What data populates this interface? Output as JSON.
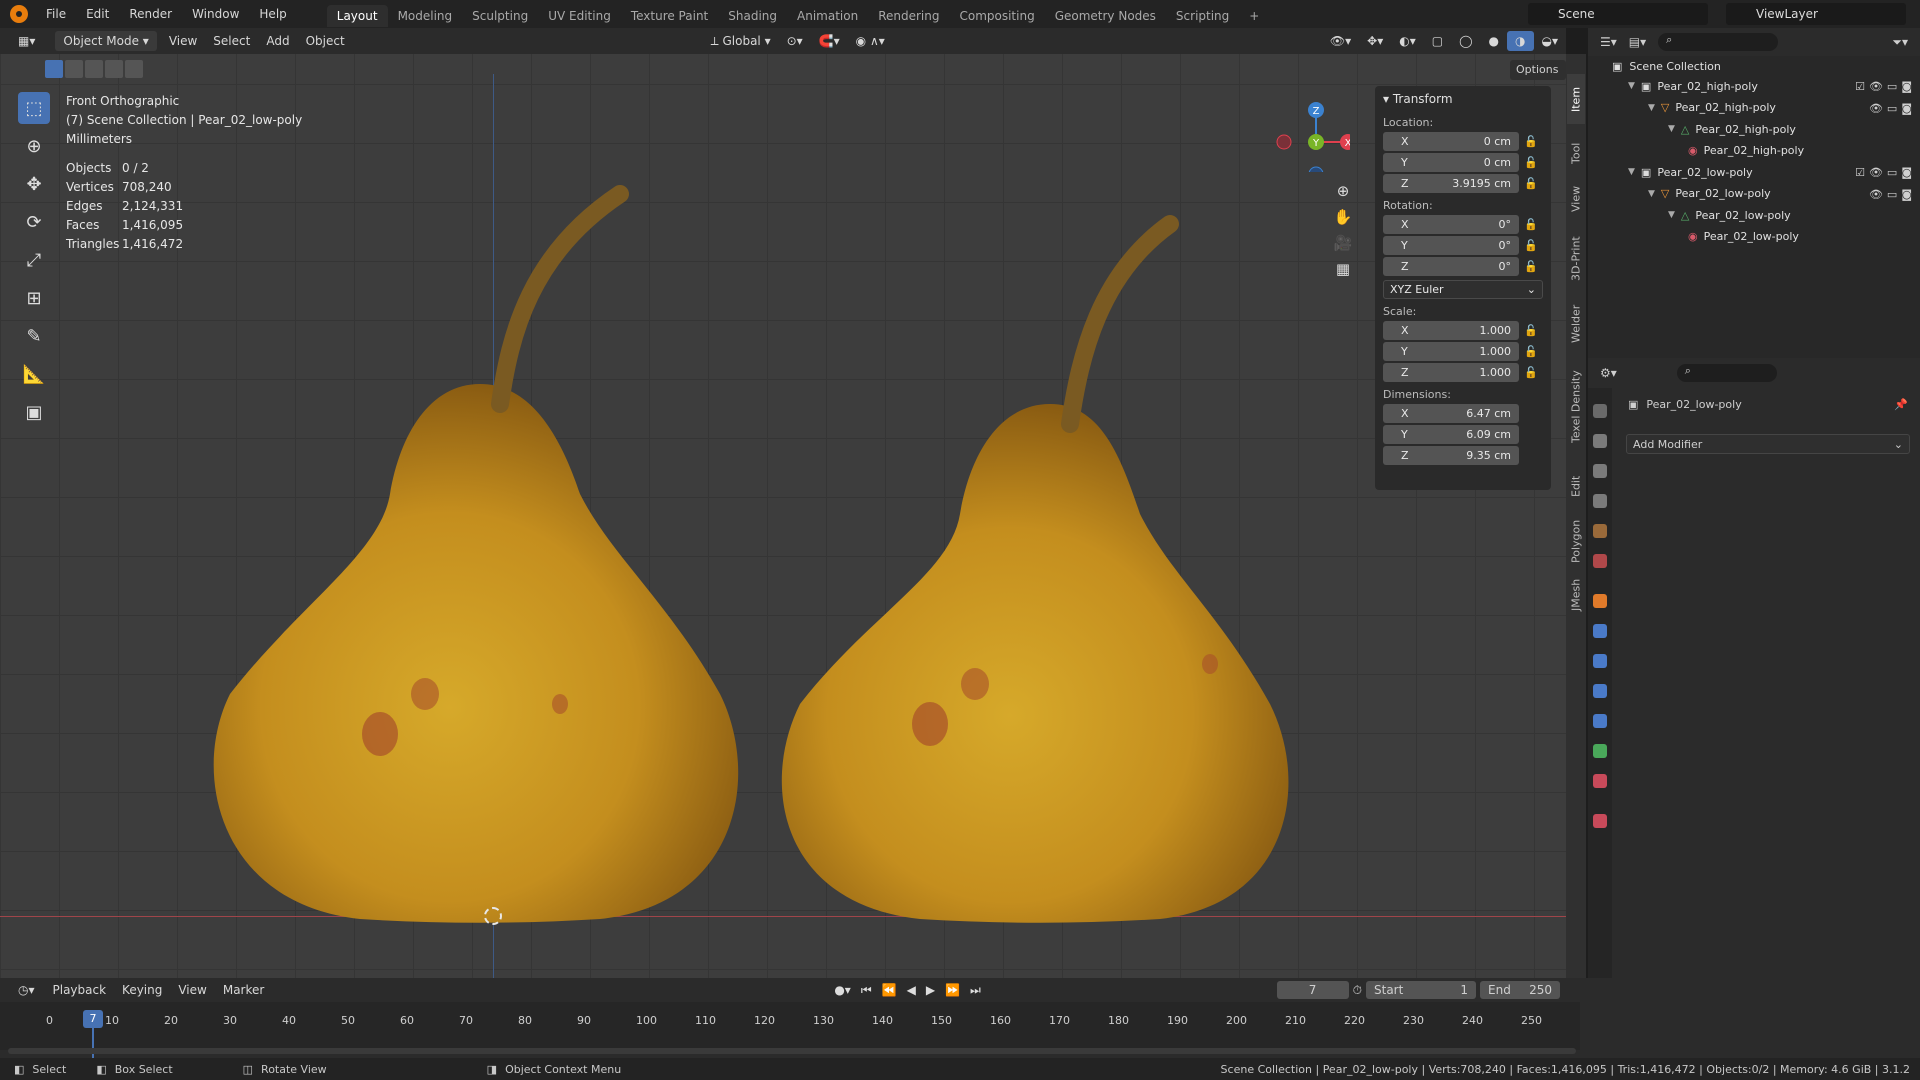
{
  "topbar": {
    "menus": [
      "File",
      "Edit",
      "Render",
      "Window",
      "Help"
    ],
    "workspaces": [
      "Layout",
      "Modeling",
      "Sculpting",
      "UV Editing",
      "Texture Paint",
      "Shading",
      "Animation",
      "Rendering",
      "Compositing",
      "Geometry Nodes",
      "Scripting"
    ],
    "active_workspace": "Layout",
    "add_tab": "+",
    "scene": "Scene",
    "view_layer": "ViewLayer"
  },
  "viewport_header": {
    "mode": "Object Mode",
    "menus": [
      "View",
      "Select",
      "Add",
      "Object"
    ],
    "orientation": "Global",
    "options": "Options"
  },
  "overlay": {
    "view_name": "Front Orthographic",
    "collection": "(7) Scene Collection | Pear_02_low-poly",
    "units": "Millimeters",
    "stats": [
      {
        "k": "Objects",
        "v": "0 / 2"
      },
      {
        "k": "Vertices",
        "v": "708,240"
      },
      {
        "k": "Edges",
        "v": "2,124,331"
      },
      {
        "k": "Faces",
        "v": "1,416,095"
      },
      {
        "k": "Triangles",
        "v": "1,416,472"
      }
    ]
  },
  "gizmo": {
    "x": "X",
    "y": "Y",
    "z": "Z",
    "colors": {
      "x": "#e0404e",
      "y": "#79b527",
      "z": "#3b82d0"
    }
  },
  "npanel": {
    "title": "Transform",
    "location_label": "Location:",
    "location": [
      {
        "axis": "X",
        "value": "0 cm"
      },
      {
        "axis": "Y",
        "value": "0 cm"
      },
      {
        "axis": "Z",
        "value": "3.9195 cm"
      }
    ],
    "rotation_label": "Rotation:",
    "rotation": [
      {
        "axis": "X",
        "value": "0°"
      },
      {
        "axis": "Y",
        "value": "0°"
      },
      {
        "axis": "Z",
        "value": "0°"
      }
    ],
    "rotation_mode": "XYZ Euler",
    "scale_label": "Scale:",
    "scale": [
      {
        "axis": "X",
        "value": "1.000"
      },
      {
        "axis": "Y",
        "value": "1.000"
      },
      {
        "axis": "Z",
        "value": "1.000"
      }
    ],
    "dimensions_label": "Dimensions:",
    "dimensions": [
      {
        "axis": "X",
        "value": "6.47 cm"
      },
      {
        "axis": "Y",
        "value": "6.09 cm"
      },
      {
        "axis": "Z",
        "value": "9.35 cm"
      }
    ]
  },
  "sidebar_tabs": [
    "Item",
    "Tool",
    "View",
    "3D-Print",
    "Welder",
    "Texel Density",
    "Edit",
    "Polygon",
    "JMesh"
  ],
  "outliner": {
    "root": "Scene Collection",
    "rows": [
      {
        "label": "Pear_02_high-poly",
        "indent": 1,
        "type": "collection"
      },
      {
        "label": "Pear_02_high-poly",
        "indent": 2,
        "type": "object"
      },
      {
        "label": "Pear_02_high-poly",
        "indent": 3,
        "type": "mesh"
      },
      {
        "label": "Pear_02_high-poly",
        "indent": 4,
        "type": "material"
      },
      {
        "label": "Pear_02_low-poly",
        "indent": 1,
        "type": "collection"
      },
      {
        "label": "Pear_02_low-poly",
        "indent": 2,
        "type": "object"
      },
      {
        "label": "Pear_02_low-poly",
        "indent": 3,
        "type": "mesh"
      },
      {
        "label": "Pear_02_low-poly",
        "indent": 4,
        "type": "material"
      }
    ]
  },
  "properties": {
    "object_name": "Pear_02_low-poly",
    "add_modifier": "Add Modifier"
  },
  "timeline": {
    "menus": [
      "Playback",
      "Keying",
      "View",
      "Marker"
    ],
    "current_frame": "7",
    "start_label": "Start",
    "start": "1",
    "end_label": "End",
    "end": "250",
    "ticks": [
      "0",
      "10",
      "20",
      "30",
      "40",
      "50",
      "60",
      "70",
      "80",
      "90",
      "100",
      "110",
      "120",
      "130",
      "140",
      "150",
      "160",
      "170",
      "180",
      "190",
      "200",
      "210",
      "220",
      "230",
      "240",
      "250"
    ]
  },
  "statusbar": {
    "select": "Select",
    "box_select": "Box Select",
    "rotate_view": "Rotate View",
    "context_menu": "Object Context Menu",
    "info": "Scene Collection | Pear_02_low-poly | Verts:708,240 | Faces:1,416,095 | Tris:1,416,472 | Objects:0/2 | Memory: 4.6 GiB | 3.1.2"
  }
}
